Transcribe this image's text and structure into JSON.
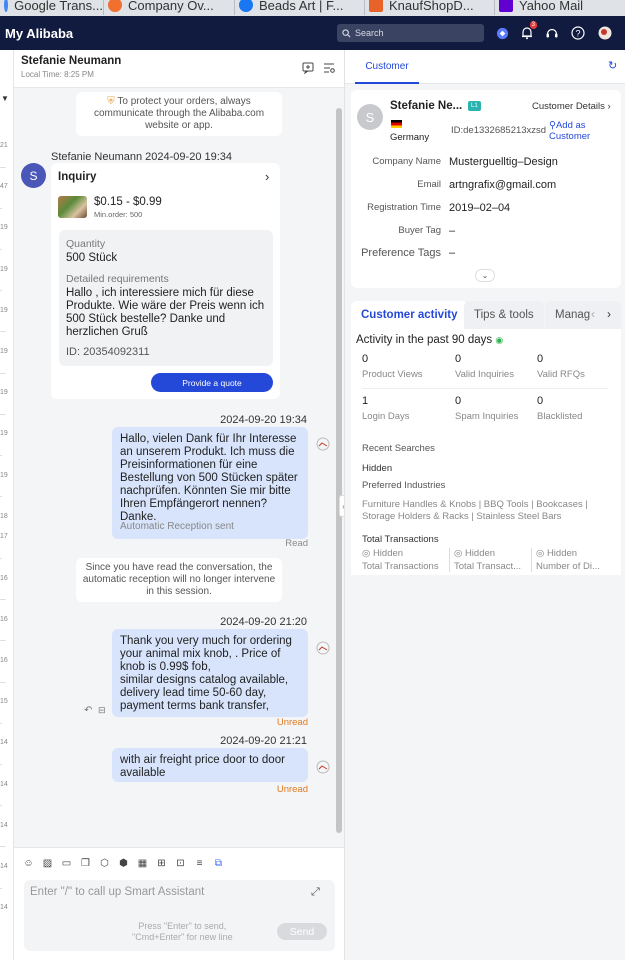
{
  "browser_tabs": [
    {
      "label": "Google Trans...",
      "color": "#4285f4"
    },
    {
      "label": "Company Ov...",
      "color": "#f07030"
    },
    {
      "label": "Beads Art | F...",
      "color": "#1877f2"
    },
    {
      "label": "KnaufShopD...",
      "color": "#e8632a"
    },
    {
      "label": "Yahoo Mail",
      "color": "#6001d2"
    }
  ],
  "topbar": {
    "brand": "My Alibaba",
    "search_placeholder": "Search",
    "notif_count": "3"
  },
  "left_strip": [
    "21",
    "...",
    "47",
    ".",
    "19",
    ".",
    "19",
    ".",
    "19",
    "...",
    "19",
    "...",
    "19",
    "...",
    "19",
    ".",
    "19",
    ".",
    "18",
    "17",
    ".",
    "16",
    "...",
    "16",
    "...",
    "16",
    "...",
    "15",
    ".",
    "14",
    ".",
    "14",
    ".",
    "14",
    "...",
    "14",
    ".",
    "14"
  ],
  "chat": {
    "contact_name": "Stefanie Neumann",
    "local_time": "Local Time: 8:25 PM",
    "notice_1": "To protect your orders,  always communicate through the Alibaba.com website or app.",
    "sender_line": "Stefanie Neumann  2024-09-20 19:34",
    "avatar_letter": "S",
    "inquiry": {
      "title": "Inquiry",
      "price": "$0.15 - $0.99",
      "min_order": "Min.order: 500",
      "qty_label": "Quantity",
      "qty_value": "500 Stück",
      "req_label": "Detailed requirements",
      "req_text": "Hallo , ich interessiere mich für diese Produkte. Wie wäre der Preis wenn ich 500 Stück bestelle? Danke und herzlichen Gruß",
      "id_text": "ID: 20354092311",
      "quote_button": "Provide a quote"
    },
    "msg1": {
      "time": "2024-09-20 19:34",
      "text": "Hallo, vielen Dank für Ihr Interesse an unserem Produkt. Ich muss die Preisinformationen für eine Bestellung von 500 Stücken später nachprüfen. Könnten Sie mir bitte Ihren Empfängerort nennen? Danke.",
      "footer": "Automatic Reception sent",
      "status": "Read"
    },
    "notice_2": "Since you have read the conversation, the automatic reception will no longer intervene in this session.",
    "msg2": {
      "time": "2024-09-20 21:20",
      "text": "Thank you very much for ordering your animal mix knob, . Price of knob is 0.99$ fob,\nsimilar designs catalog available,\ndelivery lead time 50-60 day,\npayment terms bank transfer,",
      "status": "Unread"
    },
    "msg3": {
      "time": "2024-09-20 21:21",
      "text": "with air freight price door to door available",
      "status": "Unread"
    },
    "composer": {
      "placeholder": "Enter \"/\" to call up Smart Assistant",
      "hint": "Press \"Enter\" to send,\n\"Cmd+Enter\" for new line",
      "send": "Send"
    }
  },
  "customer": {
    "tab": "Customer",
    "name": "Stefanie Ne...",
    "level": "L1",
    "details_link": "Customer Details",
    "country": "Germany",
    "id": "ID:de1332685213xzsd",
    "add_link": "Add as Customer",
    "avatar_letter": "S",
    "fields": [
      {
        "label": "Company Name",
        "value": "Musterguelltig–Design"
      },
      {
        "label": "Email",
        "value": "artngrafix@gmail.com"
      },
      {
        "label": "Registration Time",
        "value": "2019–02–04"
      },
      {
        "label": "Buyer Tag",
        "value": "–"
      },
      {
        "label": "Preference Tags",
        "value": "–"
      }
    ]
  },
  "activity": {
    "tabs": [
      "Customer activity",
      "Tips & tools",
      "Manag"
    ],
    "heading": "Activity in the past 90 days",
    "stats": [
      {
        "value": "0",
        "label": "Product Views"
      },
      {
        "value": "0",
        "label": "Valid Inquiries"
      },
      {
        "value": "0",
        "label": "Valid RFQs"
      },
      {
        "value": "1",
        "label": "Login Days"
      },
      {
        "value": "0",
        "label": "Spam Inquiries"
      },
      {
        "value": "0",
        "label": "Blacklisted"
      }
    ],
    "recent_searches_label": "Recent Searches",
    "recent_searches_value": "Hidden",
    "industries_label": "Preferred Industries",
    "industries_value": "Furniture Handles & Knobs | BBQ Tools | Bookcases | Storage Holders & Racks | Stainless Steel Bars",
    "transactions_label": "Total Transactions",
    "transactions": [
      {
        "hidden": "Hidden",
        "label": "Total Transactions"
      },
      {
        "hidden": "Hidden",
        "label": "Total Transact..."
      },
      {
        "hidden": "Hidden",
        "label": "Number of Di..."
      }
    ]
  }
}
